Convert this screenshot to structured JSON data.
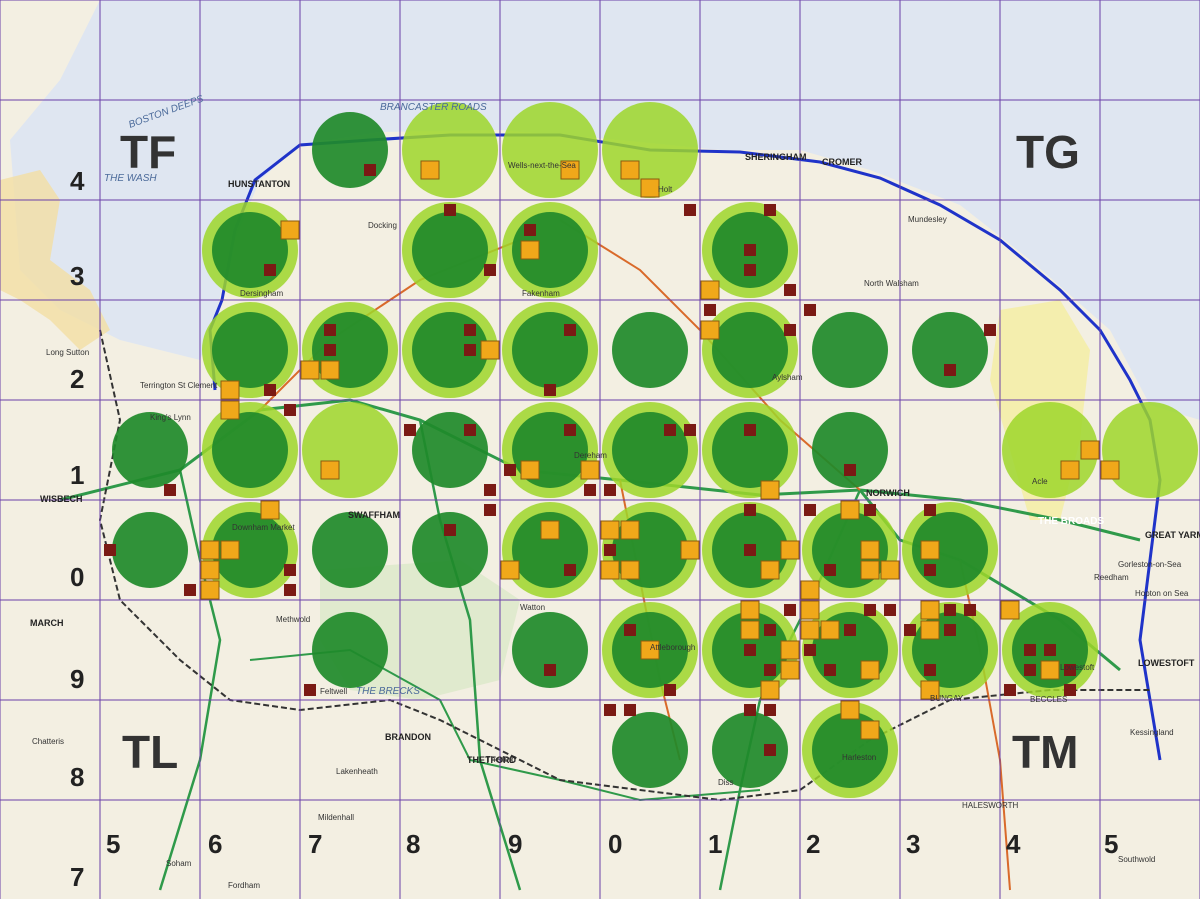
{
  "map": {
    "grid_squares": [
      "TF",
      "TG",
      "TL",
      "TM"
    ],
    "easting_labels": [
      "5",
      "6",
      "7",
      "8",
      "9",
      "0",
      "1",
      "2",
      "3",
      "4",
      "5"
    ],
    "northing_labels": [
      "4",
      "3",
      "2",
      "1",
      "0",
      "9",
      "8",
      "7"
    ],
    "place_labels": [
      "HUNSTANTON",
      "SHERINGHAM",
      "CROMER",
      "NORWICH",
      "GREAT YARMOUTH",
      "LOWESTOFT",
      "SWAFFHAM",
      "THETFORD",
      "BRANDON",
      "MARCH",
      "WISBECH",
      "BUNGAY",
      "BECCLES",
      "HALESWORTH",
      "Mundesley",
      "Lakenheath",
      "Kessingland",
      "Hopton on Sea",
      "Gorleston-on-Sea",
      "Feltwell",
      "Soham",
      "Chatteris",
      "Fordham",
      "Lowestoft",
      "Thetford",
      "Terrington St Clement",
      "Long Sutton",
      "Dersingham",
      "Docking",
      "Watton",
      "Dereham",
      "Attleborough",
      "Diss",
      "Harleston",
      "Reedham",
      "Southwold",
      "Acle",
      "Aylsham",
      "North Walsham",
      "Fakenham",
      "Holt",
      "Wells-next-the-Sea",
      "Downham Market",
      "King's Lynn",
      "Methwold",
      "Mildenhall"
    ],
    "area_labels": [
      "THE WASH",
      "THE BROADS",
      "THE BRECKS",
      "BOSTON DEEPS",
      "BRANCASTER ROADS"
    ],
    "colors": {
      "green_dark": "#1f8a2a",
      "green_light": "#9ed62a",
      "orange_square": "#f0a81a",
      "maroon_square": "#7a1a14",
      "grid": "#6a3fa8",
      "sea": "#dfe6f1",
      "land": "#f3efe2"
    }
  }
}
